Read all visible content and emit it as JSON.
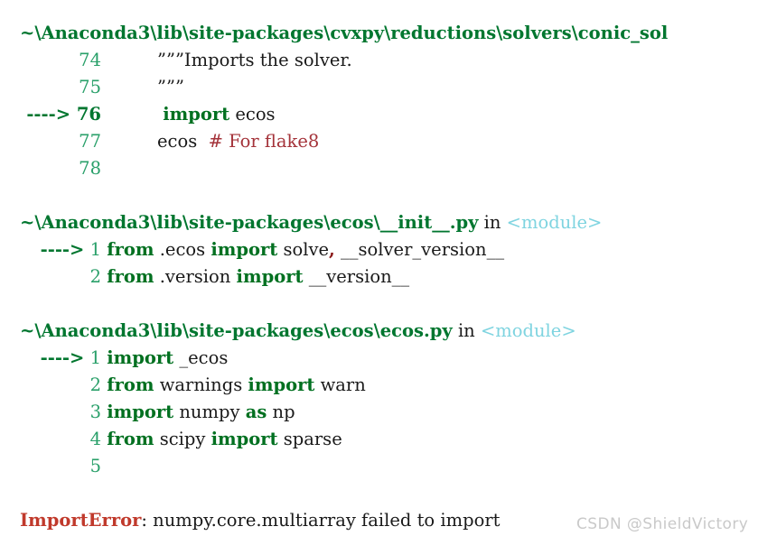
{
  "meta": {
    "kind": "ipython-traceback",
    "background_color": "#ffffff"
  },
  "colors": {
    "path": "#00762f",
    "line_number": "#2aa06a",
    "line_number_current": "#00762f",
    "keyword": "#007020",
    "comment": "#a4333a",
    "module_tag": "#7fd4e0",
    "error_type": "#c0392b",
    "text": "#1a1a1a",
    "watermark": "#c9c9c9"
  },
  "frames": [
    {
      "path": "~\\Anaconda3\\lib\\site-packages\\cvxpy\\reductions\\solvers\\conic_sol",
      "in_label": "",
      "scope": "",
      "truncated": true,
      "lines": [
        {
          "arrow": "",
          "number": "74",
          "current": false,
          "tokens": [
            {
              "t": "          ",
              "c": "plain"
            },
            {
              "t": "”””",
              "c": "str"
            },
            {
              "t": "Imports the solver.",
              "c": "str"
            }
          ]
        },
        {
          "arrow": "",
          "number": "75",
          "current": false,
          "tokens": [
            {
              "t": "          ",
              "c": "plain"
            },
            {
              "t": "”””",
              "c": "str"
            }
          ]
        },
        {
          "arrow": "---->",
          "number": "76",
          "current": true,
          "tokens": [
            {
              "t": "           ",
              "c": "plain"
            },
            {
              "t": "import",
              "c": "kw"
            },
            {
              "t": " ecos",
              "c": "nam"
            }
          ]
        },
        {
          "arrow": "",
          "number": "77",
          "current": false,
          "tokens": [
            {
              "t": "          ",
              "c": "plain"
            },
            {
              "t": "ecos  ",
              "c": "nam"
            },
            {
              "t": "# For flake8",
              "c": "com"
            }
          ]
        },
        {
          "arrow": "",
          "number": "78",
          "current": false,
          "tokens": []
        }
      ]
    },
    {
      "path": "~\\Anaconda3\\lib\\site-packages\\ecos\\__init__.py",
      "in_label": "in",
      "scope": "<module>",
      "truncated": false,
      "lines": [
        {
          "arrow": "---->",
          "number": "1",
          "current": false,
          "tokens": [
            {
              "t": " ",
              "c": "plain"
            },
            {
              "t": "from",
              "c": "kw"
            },
            {
              "t": " .ecos ",
              "c": "nam"
            },
            {
              "t": "import",
              "c": "kw"
            },
            {
              "t": " solve",
              "c": "nam"
            },
            {
              "t": ",",
              "c": "punc"
            },
            {
              "t": " __solver_version__",
              "c": "nam"
            }
          ]
        },
        {
          "arrow": "",
          "number": "2",
          "current": false,
          "tokens": [
            {
              "t": " ",
              "c": "plain"
            },
            {
              "t": "from",
              "c": "kw"
            },
            {
              "t": " .version ",
              "c": "nam"
            },
            {
              "t": "import",
              "c": "kw"
            },
            {
              "t": " __version__",
              "c": "nam"
            }
          ]
        }
      ]
    },
    {
      "path": "~\\Anaconda3\\lib\\site-packages\\ecos\\ecos.py",
      "in_label": "in",
      "scope": "<module>",
      "truncated": false,
      "lines": [
        {
          "arrow": "---->",
          "number": "1",
          "current": false,
          "tokens": [
            {
              "t": " ",
              "c": "plain"
            },
            {
              "t": "import",
              "c": "kw"
            },
            {
              "t": " _ecos",
              "c": "nam"
            }
          ]
        },
        {
          "arrow": "",
          "number": "2",
          "current": false,
          "tokens": [
            {
              "t": " ",
              "c": "plain"
            },
            {
              "t": "from",
              "c": "kw"
            },
            {
              "t": " warnings ",
              "c": "nam"
            },
            {
              "t": "import",
              "c": "kw"
            },
            {
              "t": " warn",
              "c": "nam"
            }
          ]
        },
        {
          "arrow": "",
          "number": "3",
          "current": false,
          "tokens": [
            {
              "t": " ",
              "c": "plain"
            },
            {
              "t": "import",
              "c": "kw"
            },
            {
              "t": " numpy ",
              "c": "nam"
            },
            {
              "t": "as",
              "c": "kw"
            },
            {
              "t": " np",
              "c": "nam"
            }
          ]
        },
        {
          "arrow": "",
          "number": "4",
          "current": false,
          "tokens": [
            {
              "t": " ",
              "c": "plain"
            },
            {
              "t": "from",
              "c": "kw"
            },
            {
              "t": " scipy ",
              "c": "nam"
            },
            {
              "t": "import",
              "c": "kw"
            },
            {
              "t": " sparse",
              "c": "nam"
            }
          ]
        },
        {
          "arrow": "",
          "number": "5",
          "current": false,
          "tokens": []
        }
      ]
    }
  ],
  "error": {
    "type": "ImportError",
    "separator": ": ",
    "message": "numpy.core.multiarray failed to import"
  },
  "watermark": {
    "text": "CSDN @ShieldVictory"
  }
}
